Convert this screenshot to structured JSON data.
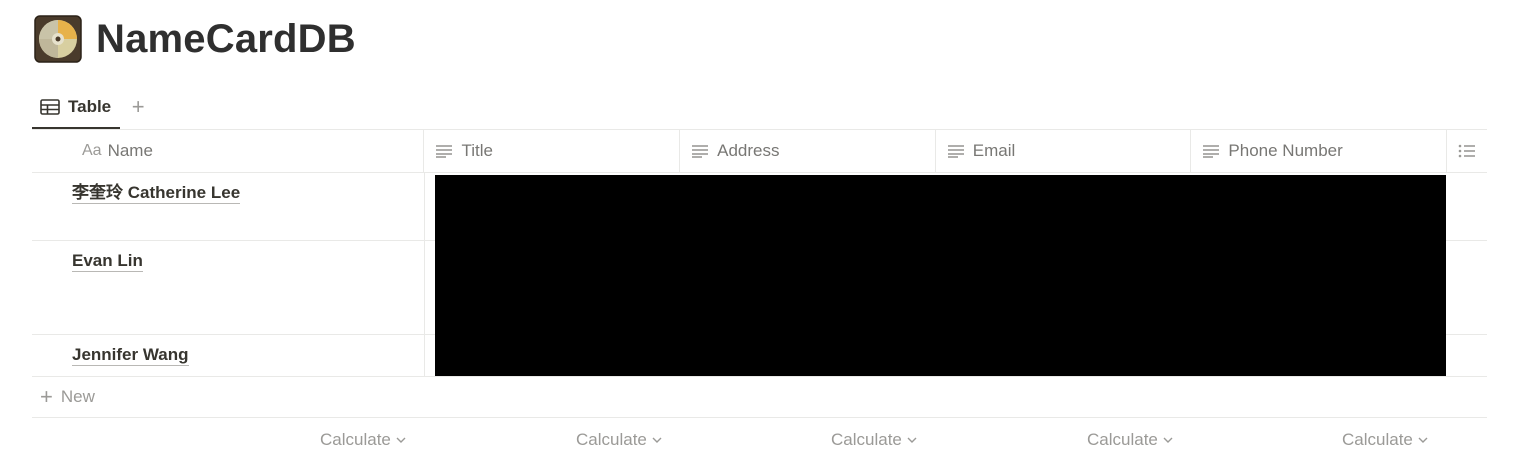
{
  "header": {
    "title": "NameCardDB",
    "icon": "cd-disc-icon"
  },
  "tabs": [
    {
      "label": "Table",
      "icon": "table-icon",
      "active": true
    }
  ],
  "add_view_label": "+",
  "table": {
    "columns": [
      {
        "label": "Name",
        "type_icon": "Aa"
      },
      {
        "label": "Title",
        "type_icon": "text-icon"
      },
      {
        "label": "Address",
        "type_icon": "text-icon"
      },
      {
        "label": "Email",
        "type_icon": "text-icon"
      },
      {
        "label": "Phone Number",
        "type_icon": "text-icon"
      },
      {
        "label": "",
        "type_icon": "list-icon"
      }
    ],
    "rows": [
      {
        "name": "李奎玲 Catherine Lee"
      },
      {
        "name": "Evan Lin"
      },
      {
        "name": "Jennifer Wang"
      }
    ],
    "new_label": "New",
    "calculate_label": "Calculate"
  },
  "colors": {
    "text": "#37352f",
    "muted": "#9b9a97",
    "border": "#e9e9e7",
    "redaction": "#000000"
  }
}
